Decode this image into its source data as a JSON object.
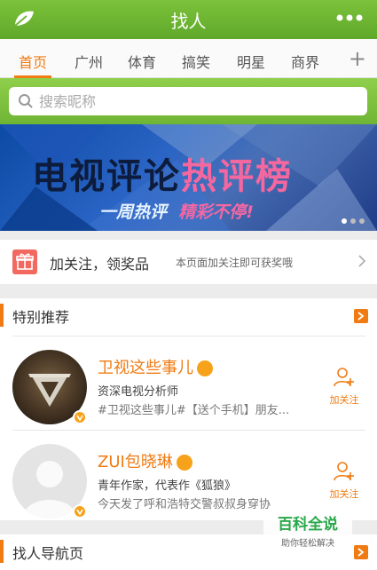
{
  "app": {
    "title": "找人"
  },
  "tabs": [
    {
      "label": "首页",
      "active": true
    },
    {
      "label": "广州"
    },
    {
      "label": "体育"
    },
    {
      "label": "搞笑"
    },
    {
      "label": "明星"
    },
    {
      "label": "商界"
    }
  ],
  "tabs_add": "+",
  "search": {
    "placeholder": "搜索昵称",
    "value": ""
  },
  "banner": {
    "title_part1": "电视评论",
    "title_part2": "热评榜",
    "subtitle_part1": "一周热评",
    "subtitle_part2": "精彩不停!",
    "slides": 3,
    "active_slide": 1
  },
  "follow_promo": {
    "title": "加关注，领奖品",
    "description": "本页面加关注即可获奖哦"
  },
  "recommended": {
    "title": "特别推荐",
    "people": [
      {
        "name": "卫视这些事儿",
        "bio": "资深电视分析师",
        "latest": "#卫视这些事儿#【送个手机】朋友...",
        "follow_label": "加关注"
      },
      {
        "name": "ZUI包晓琳",
        "bio": "青年作家，代表作《狐狼》",
        "latest": "今天发了呼和浩特交警叔叔身穿协",
        "follow_label": "加关注"
      }
    ]
  },
  "nav_section": {
    "title": "找人导航页"
  },
  "watermark": {
    "title": "百科全说",
    "subtitle": "助你轻松解决"
  },
  "colors": {
    "brand_green": "#6fb534",
    "accent_orange": "#f07b13",
    "gift_red": "#f26a5f"
  }
}
